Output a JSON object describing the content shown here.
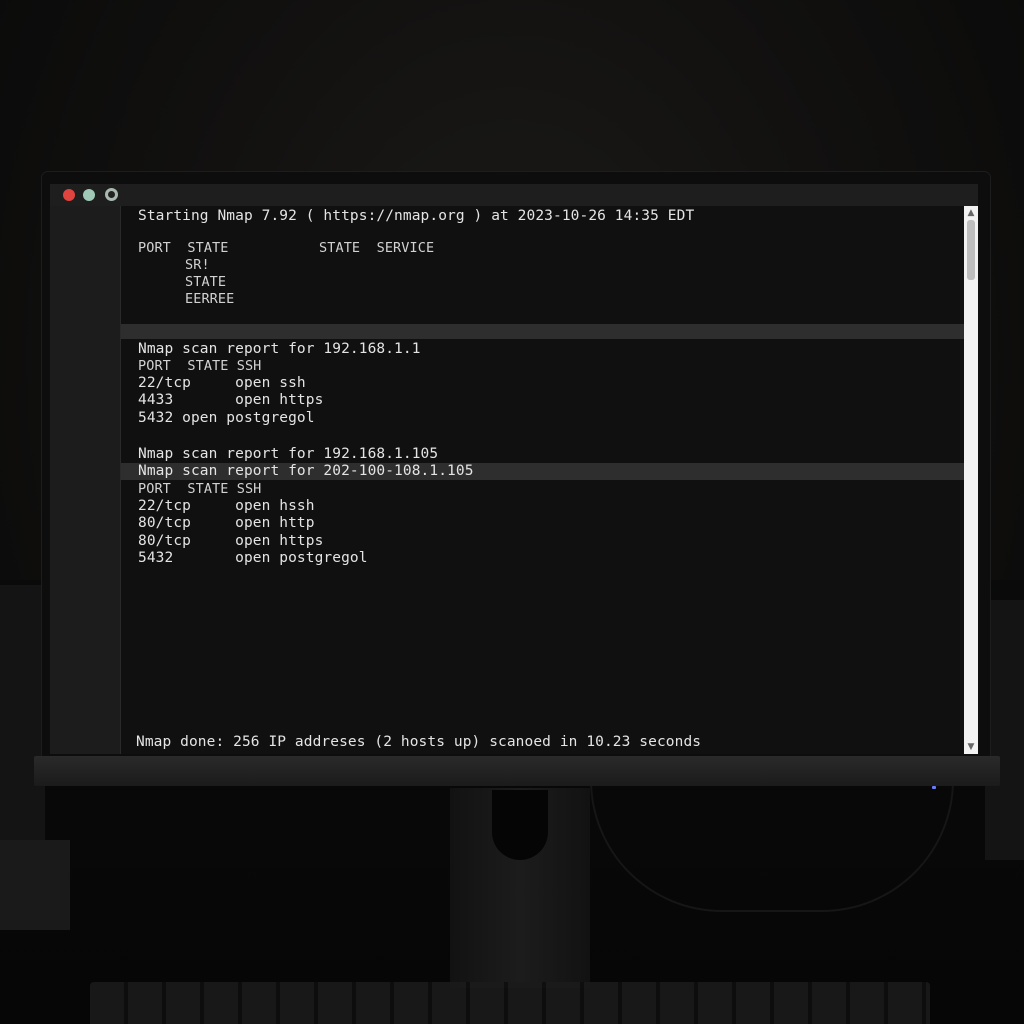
{
  "terminal": {
    "header_line": "Starting Nmap 7.92 ( https://nmap.org ) at 2023-10-26 14:35 EDT",
    "header_cols": "PORT  STATE           STATE  SERVICE",
    "header_sub": [
      "SR!",
      "STATE",
      "EERREE"
    ],
    "scan1": {
      "title": "Nmap scan report for 192.168.1.1",
      "cols": "PORT  STATE SSH",
      "rows": [
        "22/tcp     open ssh",
        "4433       open https",
        "5432 open postgregol"
      ]
    },
    "scan2": {
      "title": "Nmap scan report for 192.168.1.105",
      "title_highlighted": "Nmap scan report for 202-100-108.1.105",
      "cols": "PORT  STATE SSH",
      "rows": [
        "22/tcp     open hssh",
        "80/tcp     open http",
        "80/tcp     open https",
        "5432       open postgregol"
      ]
    },
    "footer_line": "Nmap done: 256 IP addreses (2 hosts up) scanoed in 10.23 seconds"
  },
  "colors": {
    "close": "#e0443e",
    "minimize": "#9fc9b6",
    "terminal_bg": "#101010",
    "text": "#e4e4e4"
  },
  "icons": [
    "close-light-icon",
    "minimize-light-icon",
    "zoom-light-icon",
    "scroll-up-arrow-icon",
    "scroll-down-arrow-icon"
  ]
}
